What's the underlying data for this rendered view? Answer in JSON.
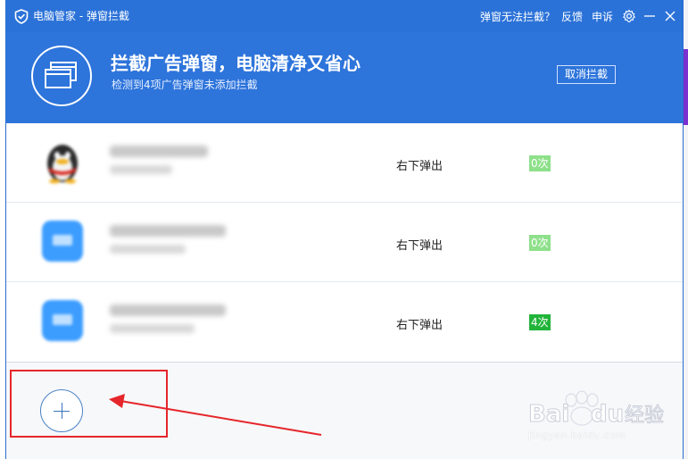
{
  "window": {
    "title": "电脑管家 - 弹窗拦截",
    "help_link": "弹窗无法拦截？",
    "feedback_link": "反馈",
    "complaint_link": "申诉"
  },
  "banner": {
    "title": "拦截广告弹窗，电脑清净又省心",
    "subtitle": "检测到4项广告弹窗未添加拦截",
    "cancel_button": "取消拦截"
  },
  "items": [
    {
      "icon": "qq-penguin-icon",
      "position": "右下弹出",
      "count": "0次",
      "badge_color": "#8ee08a"
    },
    {
      "icon": "app-icon",
      "position": "右下弹出",
      "count": "0次",
      "badge_color": "#8ee08a"
    },
    {
      "icon": "app-icon",
      "position": "右下弹出",
      "count": "4次",
      "badge_color": "#22b43a"
    }
  ],
  "add_button": {
    "icon": "plus-icon"
  },
  "annotation": {
    "color": "#e5262b"
  },
  "watermark": {
    "brand": "Baidu经验",
    "url": "jingyan.baidu.com"
  },
  "colors": {
    "title_bar": "#2b72d8",
    "banner": "#2d74db",
    "accent": "#3a73bb"
  }
}
